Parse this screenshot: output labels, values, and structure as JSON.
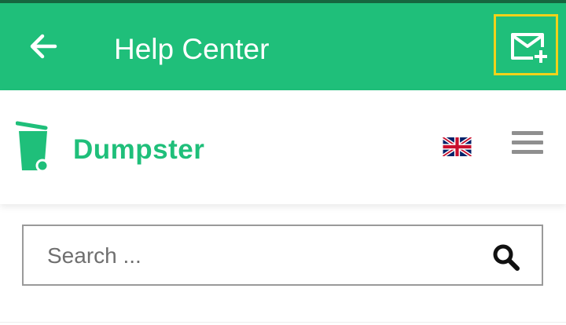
{
  "appbar": {
    "title": "Help Center",
    "back_icon": "arrow-left-icon",
    "compose_icon": "mail-plus-icon",
    "background_color": "#1fbf7a"
  },
  "site_header": {
    "brand_name": "Dumpster",
    "brand_color": "#1fbf7a",
    "logo_icon": "trash-can-icon",
    "language_flag_icon": "uk-flag-icon",
    "menu_icon": "hamburger-menu-icon"
  },
  "search": {
    "placeholder": "Search ...",
    "value": "",
    "icon": "search-icon"
  }
}
